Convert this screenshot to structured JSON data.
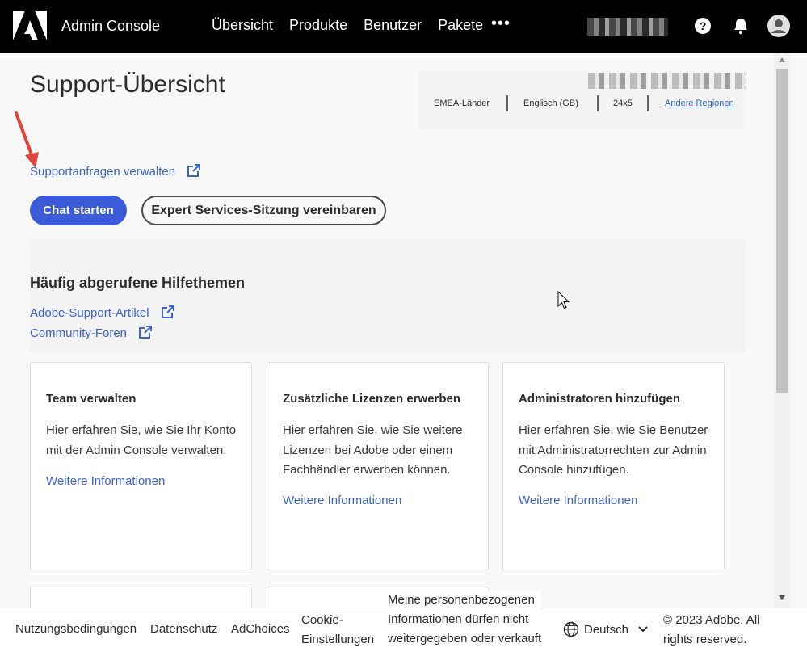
{
  "header": {
    "app_title": "Admin Console",
    "nav": [
      "Übersicht",
      "Produkte",
      "Benutzer",
      "Pakete"
    ],
    "more": "•••"
  },
  "page": {
    "title": "Support-Übersicht"
  },
  "region": {
    "area": "EMEA-Länder",
    "language": "Englisch (GB)",
    "hours": "24x5",
    "other_link": "Andere Regionen"
  },
  "support": {
    "manage_link": "Supportanfragen verwalten",
    "chat_button": "Chat starten",
    "expert_button": "Expert Services-Sitzung vereinbaren"
  },
  "help": {
    "title": "Häufig abgerufene Hilfethemen",
    "links": [
      "Adobe-Support-Artikel",
      "Community-Foren"
    ]
  },
  "cards": [
    {
      "title": "Team verwalten",
      "text": "Hier erfahren Sie, wie Sie Ihr Konto mit der Admin Console verwalten.",
      "link": "Weitere Informationen"
    },
    {
      "title": "Zusätzliche Lizenzen erwerben",
      "text": "Hier erfahren Sie, wie Sie weitere Lizenzen bei Adobe oder einem Fachhändler erwerben können.",
      "link": "Weitere Informationen"
    },
    {
      "title": "Administratoren hinzufügen",
      "text": "Hier erfahren Sie, wie Sie Benutzer mit Administratorrechten zur Admin Console hinzufügen.",
      "link": "Weitere Informationen"
    }
  ],
  "footer": {
    "terms": "Nutzungsbedingungen",
    "privacy": "Datenschutz",
    "adchoices": "AdChoices",
    "cookie_line1": "Cookie-",
    "cookie_line2": "Einstellungen",
    "donotsell_line1": "Meine personenbezogenen",
    "donotsell_line2": "Informationen dürfen nicht",
    "donotsell_line3": "weitergegeben oder verkauft",
    "language": "Deutsch",
    "copyright_line1": "© 2023 Adobe. All",
    "copyright_line2": "rights reserved."
  },
  "colors": {
    "topbar": "#000000",
    "accent": "#3b5bdb",
    "link": "#3b63d1",
    "annotation_arrow": "#e0453a"
  },
  "icons": [
    "adobe-logo-icon",
    "help-icon",
    "bell-icon",
    "avatar-icon",
    "external-link-icon",
    "globe-icon",
    "chevron-down-icon",
    "cursor-icon",
    "annotation-arrow-icon"
  ]
}
